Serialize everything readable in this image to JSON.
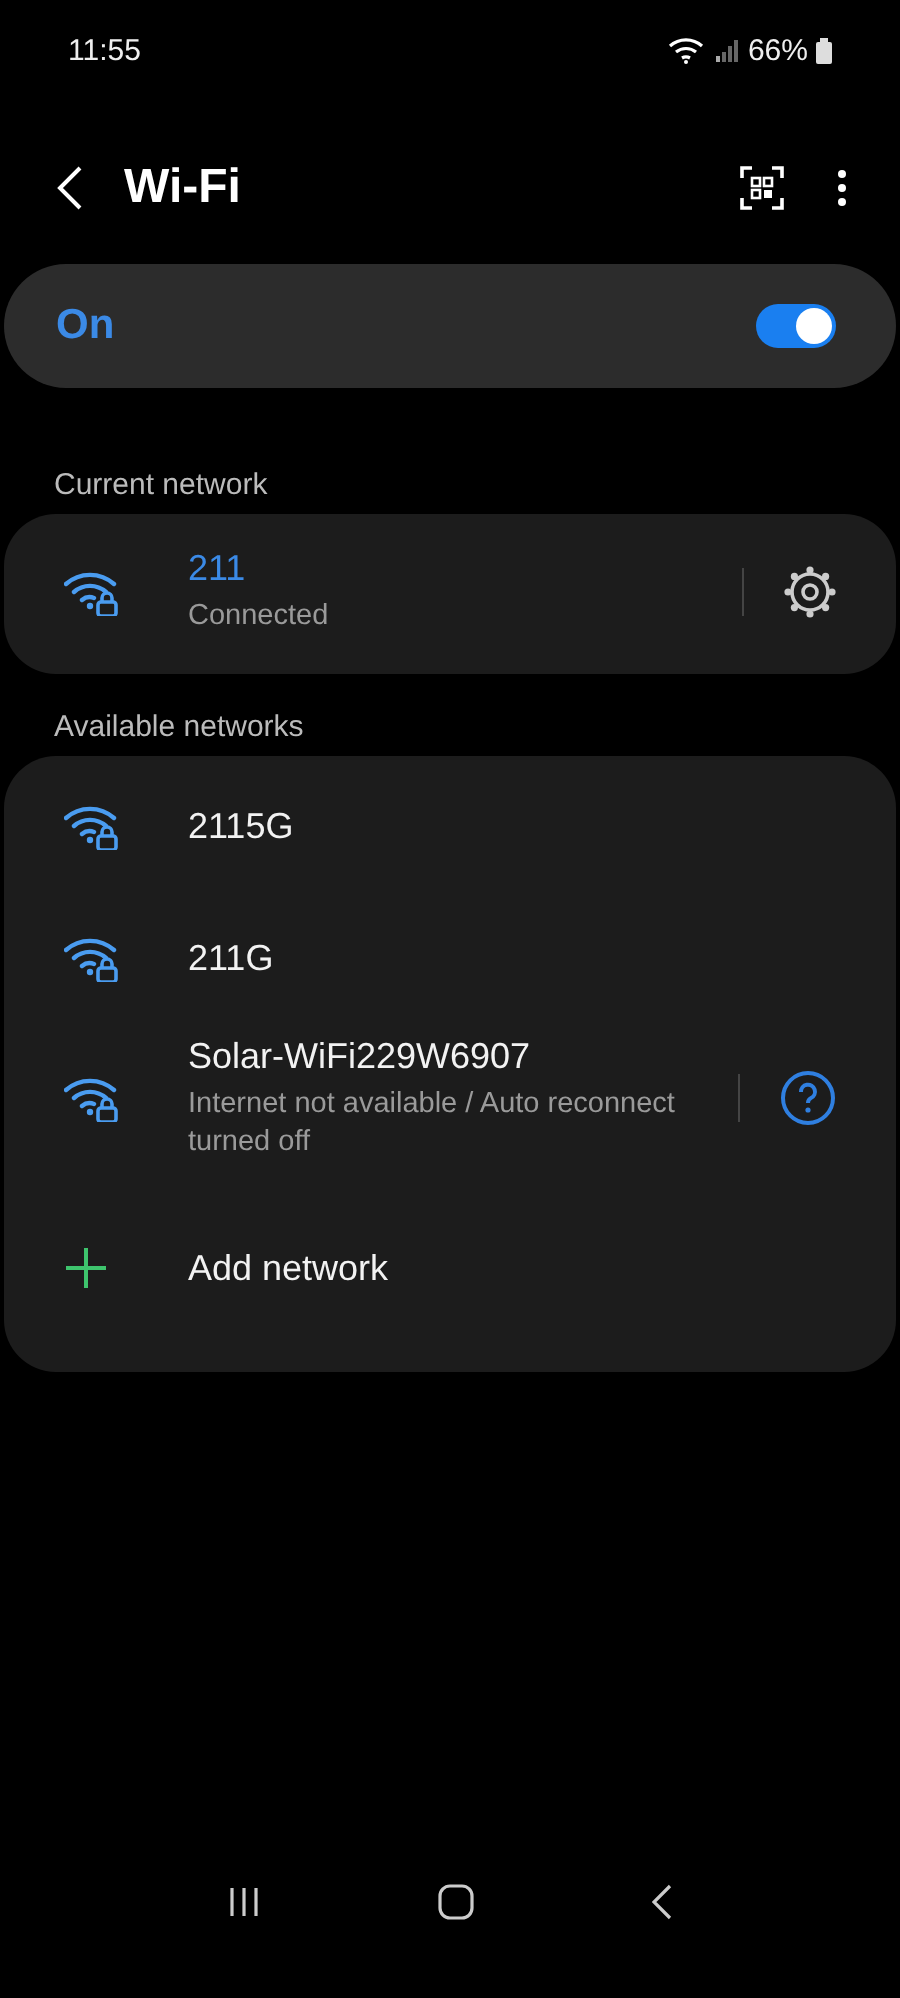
{
  "status_bar": {
    "time": "11:55",
    "battery": "66%"
  },
  "header": {
    "title": "Wi-Fi"
  },
  "master_switch": {
    "label": "On",
    "on": true
  },
  "current_network": {
    "heading": "Current network",
    "networks": [
      {
        "kind": "wifi",
        "name": "211",
        "subtitle": "Connected",
        "connected": true,
        "action": {
          "kind": "settings"
        }
      }
    ]
  },
  "available_networks": {
    "heading": "Available networks",
    "networks": [
      {
        "kind": "wifi",
        "name": "2115G",
        "connected": false
      },
      {
        "kind": "wifi",
        "name": "211G",
        "connected": false
      },
      {
        "kind": "wifi",
        "name": "Solar-WiFi229W6907",
        "subtitle": "Internet not available / Auto reconnect turned off",
        "connected": false,
        "action": {
          "kind": "info"
        }
      },
      {
        "kind": "add",
        "name": "Add network"
      }
    ]
  }
}
